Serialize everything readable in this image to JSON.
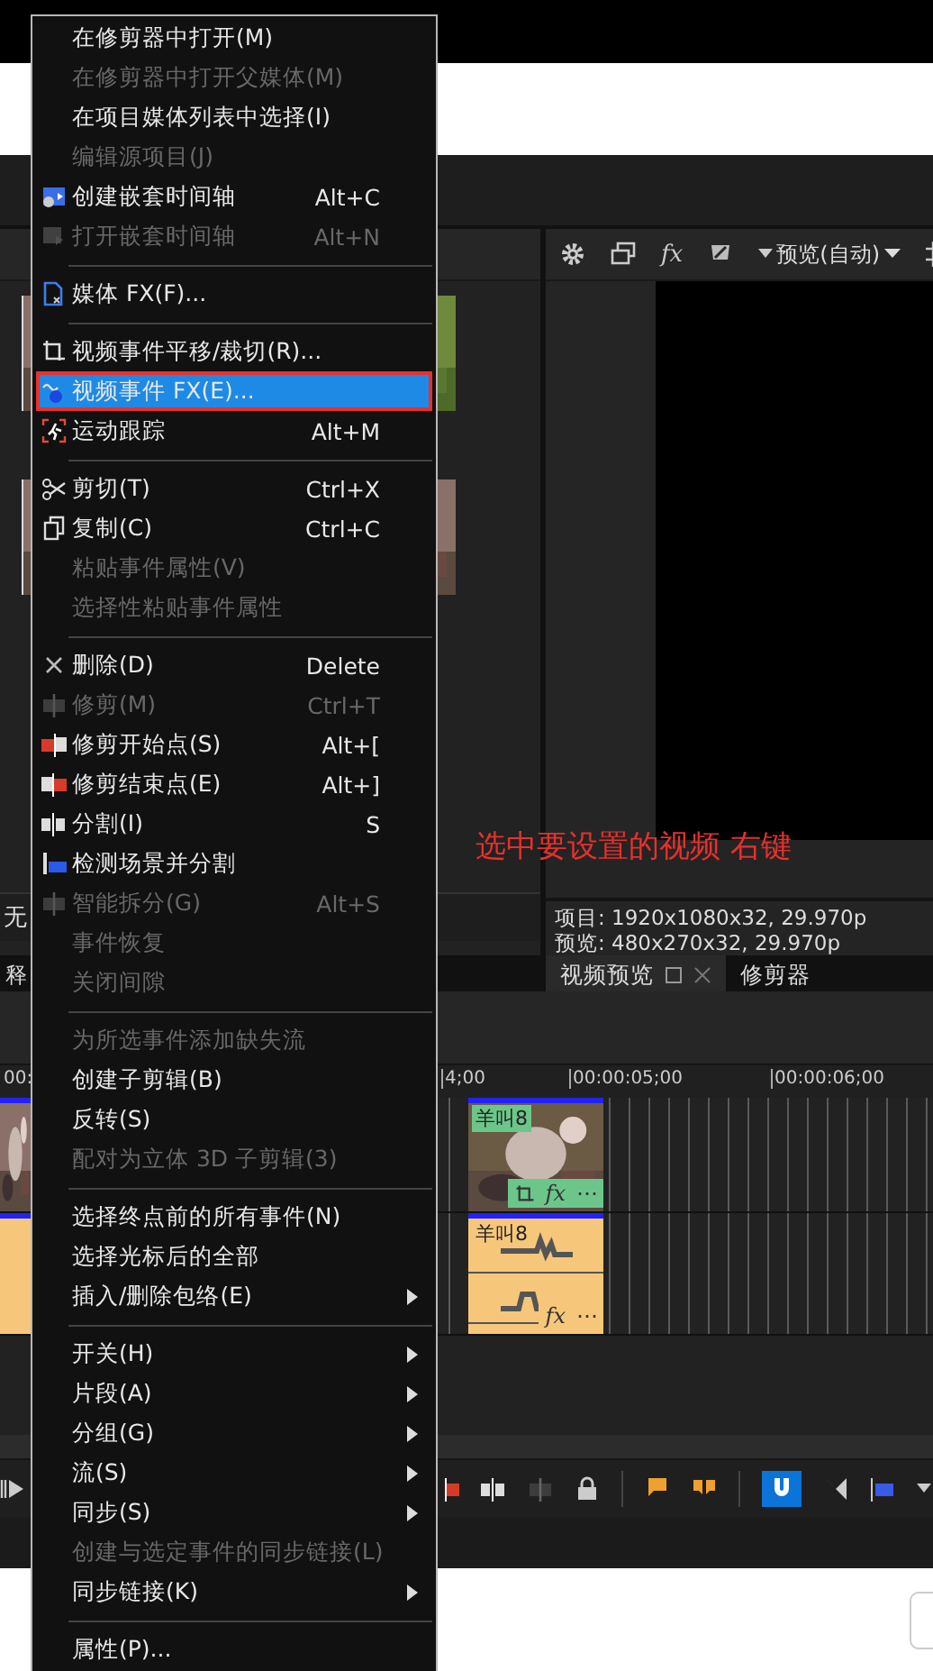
{
  "media_panel": {
    "status": "无",
    "tab": "释"
  },
  "preview": {
    "toolbar": {
      "fx_label": "fx",
      "quality": "预览(自动)"
    },
    "annotation": "选中要设置的视频 右键",
    "info": [
      "项目: 1920x1080x32, 29.970p",
      "预览: 480x270x32, 29.970p"
    ],
    "tabs": [
      {
        "label": "视频预览",
        "selected": true
      },
      {
        "label": "修剪器",
        "selected": false
      }
    ]
  },
  "timeline": {
    "ruler": [
      "00:",
      "4;00",
      "00:00:05;00",
      "00:00:06;00"
    ],
    "video_event": {
      "label": "羊叫8",
      "buttons": [
        "fx",
        "⋯"
      ]
    },
    "audio_event": {
      "label": "羊叫8",
      "buttons": [
        "fx",
        "⋯"
      ]
    }
  },
  "context_menu": {
    "items": [
      {
        "kind": "item",
        "label": "在修剪器中打开(M)",
        "disabled": false,
        "selected": false,
        "submenu": false
      },
      {
        "kind": "item",
        "label": "在修剪器中打开父媒体(M)",
        "disabled": true,
        "selected": false,
        "submenu": false
      },
      {
        "kind": "item",
        "label": "在项目媒体列表中选择(I)",
        "disabled": false,
        "selected": false,
        "submenu": false
      },
      {
        "kind": "item",
        "label": "编辑源项目(J)",
        "disabled": true,
        "selected": false,
        "submenu": false
      },
      {
        "kind": "item",
        "label": "创建嵌套时间轴",
        "shortcut": "Alt+C",
        "disabled": false,
        "selected": false,
        "submenu": false
      },
      {
        "kind": "item",
        "label": "打开嵌套时间轴",
        "shortcut": "Alt+N",
        "disabled": true,
        "selected": false,
        "submenu": false
      },
      {
        "kind": "separator"
      },
      {
        "kind": "item",
        "label": "媒体 FX(F)...",
        "disabled": false,
        "selected": false,
        "submenu": false
      },
      {
        "kind": "separator"
      },
      {
        "kind": "item",
        "label": "视频事件平移/裁切(R)...",
        "disabled": false,
        "selected": false,
        "submenu": false
      },
      {
        "kind": "item",
        "label": "视频事件 FX(E)...",
        "disabled": false,
        "selected": true,
        "submenu": false
      },
      {
        "kind": "item",
        "label": "运动跟踪",
        "shortcut": "Alt+M",
        "disabled": false,
        "selected": false,
        "submenu": false
      },
      {
        "kind": "separator"
      },
      {
        "kind": "item",
        "label": "剪切(T)",
        "shortcut": "Ctrl+X",
        "disabled": false,
        "selected": false,
        "submenu": false
      },
      {
        "kind": "item",
        "label": "复制(C)",
        "shortcut": "Ctrl+C",
        "disabled": false,
        "selected": false,
        "submenu": false
      },
      {
        "kind": "item",
        "label": "粘贴事件属性(V)",
        "disabled": true,
        "selected": false,
        "submenu": false
      },
      {
        "kind": "item",
        "label": "选择性粘贴事件属性",
        "disabled": true,
        "selected": false,
        "submenu": false
      },
      {
        "kind": "separator"
      },
      {
        "kind": "item",
        "label": "删除(D)",
        "shortcut": "Delete",
        "disabled": false,
        "selected": false,
        "submenu": false
      },
      {
        "kind": "item",
        "label": "修剪(M)",
        "shortcut": "Ctrl+T",
        "disabled": true,
        "selected": false,
        "submenu": false
      },
      {
        "kind": "item",
        "label": "修剪开始点(S)",
        "shortcut": "Alt+[",
        "disabled": false,
        "selected": false,
        "submenu": false
      },
      {
        "kind": "item",
        "label": "修剪结束点(E)",
        "shortcut": "Alt+]",
        "disabled": false,
        "selected": false,
        "submenu": false
      },
      {
        "kind": "item",
        "label": "分割(I)",
        "shortcut": "S",
        "disabled": false,
        "selected": false,
        "submenu": false
      },
      {
        "kind": "item",
        "label": "检测场景并分割",
        "disabled": false,
        "selected": false,
        "submenu": false
      },
      {
        "kind": "item",
        "label": "智能拆分(G)",
        "shortcut": "Alt+S",
        "disabled": true,
        "selected": false,
        "submenu": false
      },
      {
        "kind": "item",
        "label": "事件恢复",
        "disabled": true,
        "selected": false,
        "submenu": false
      },
      {
        "kind": "item",
        "label": "关闭间隙",
        "disabled": true,
        "selected": false,
        "submenu": false
      },
      {
        "kind": "separator"
      },
      {
        "kind": "item",
        "label": "为所选事件添加缺失流",
        "disabled": true,
        "selected": false,
        "submenu": false
      },
      {
        "kind": "item",
        "label": "创建子剪辑(B)",
        "disabled": false,
        "selected": false,
        "submenu": false
      },
      {
        "kind": "item",
        "label": "反转(S)",
        "disabled": false,
        "selected": false,
        "submenu": false
      },
      {
        "kind": "item",
        "label": "配对为立体 3D 子剪辑(3)",
        "disabled": true,
        "selected": false,
        "submenu": false
      },
      {
        "kind": "separator"
      },
      {
        "kind": "item",
        "label": "选择终点前的所有事件(N)",
        "disabled": false,
        "selected": false,
        "submenu": false
      },
      {
        "kind": "item",
        "label": "选择光标后的全部",
        "disabled": false,
        "selected": false,
        "submenu": false
      },
      {
        "kind": "item",
        "label": "插入/删除包络(E)",
        "disabled": false,
        "selected": false,
        "submenu": true
      },
      {
        "kind": "separator"
      },
      {
        "kind": "item",
        "label": "开关(H)",
        "disabled": false,
        "selected": false,
        "submenu": true
      },
      {
        "kind": "item",
        "label": "片段(A)",
        "disabled": false,
        "selected": false,
        "submenu": true
      },
      {
        "kind": "item",
        "label": "分组(G)",
        "disabled": false,
        "selected": false,
        "submenu": true
      },
      {
        "kind": "item",
        "label": "流(S)",
        "disabled": false,
        "selected": false,
        "submenu": true
      },
      {
        "kind": "item",
        "label": "同步(S)",
        "disabled": false,
        "selected": false,
        "submenu": true
      },
      {
        "kind": "item",
        "label": "创建与选定事件的同步链接(L)",
        "disabled": true,
        "selected": false,
        "submenu": false
      },
      {
        "kind": "item",
        "label": "同步链接(K)",
        "disabled": false,
        "selected": false,
        "submenu": true
      },
      {
        "kind": "separator"
      },
      {
        "kind": "item",
        "label": "属性(P)...",
        "disabled": false,
        "selected": false,
        "submenu": false
      }
    ]
  }
}
